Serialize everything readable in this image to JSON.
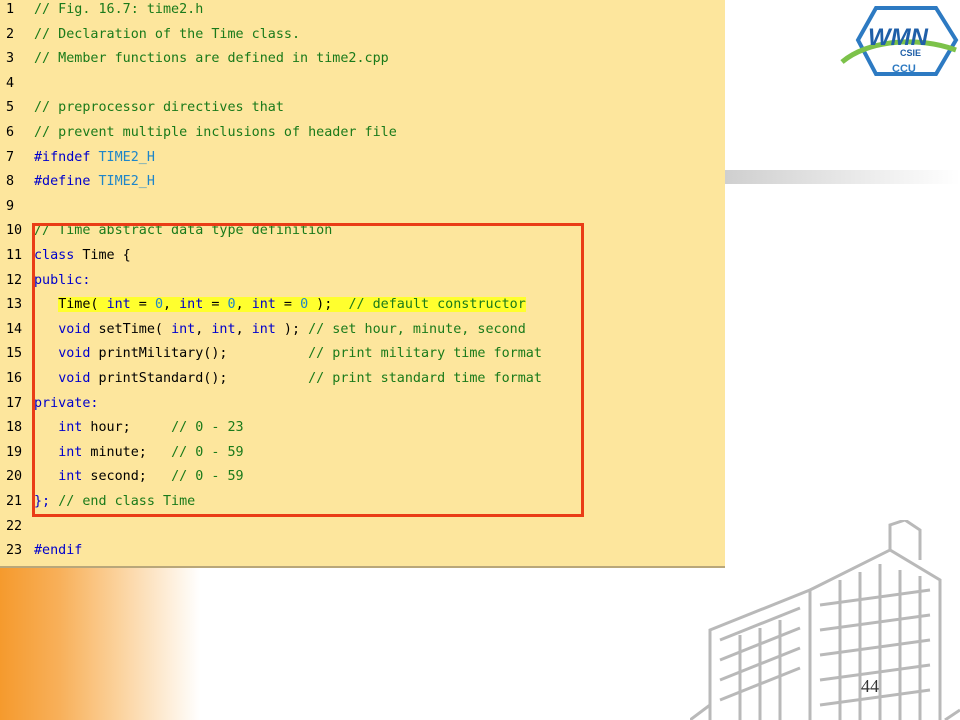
{
  "slide": {
    "page_number": "44",
    "logo": {
      "text_main": "WMN",
      "text_sub": "CSIE",
      "text_bottom": "CCU"
    },
    "colors": {
      "panel_bg": "#fde69d",
      "highlight": "#ffff2e",
      "box_border": "#ea3c16",
      "comment": "#1a7a1a",
      "keyword": "#0000cc",
      "number": "#1f86c9"
    }
  },
  "code": [
    {
      "n": "1",
      "t": "// Fig. 16.7: time2.h"
    },
    {
      "n": "2",
      "t": "// Declaration of the Time class."
    },
    {
      "n": "3",
      "t": "// Member functions are defined in time2.cpp"
    },
    {
      "n": "4",
      "t": ""
    },
    {
      "n": "5",
      "t": "// preprocessor directives that"
    },
    {
      "n": "6",
      "t": "// prevent multiple inclusions of header file"
    },
    {
      "n": "7",
      "a": "#ifndef",
      "b": "TIME2_H"
    },
    {
      "n": "8",
      "a": "#define",
      "b": "TIME2_H"
    },
    {
      "n": "9",
      "t": ""
    },
    {
      "n": "10",
      "t": "// Time abstract data type definition"
    },
    {
      "n": "11",
      "a": "class",
      "b": " Time {"
    },
    {
      "n": "12",
      "t": "public:"
    },
    {
      "n": "13",
      "p": [
        "Time( ",
        "int",
        " = ",
        "0",
        ", ",
        "int",
        " = ",
        "0",
        ", ",
        "int",
        " = ",
        "0",
        " );  ",
        "// default constructor"
      ]
    },
    {
      "n": "14",
      "p": [
        "void",
        " setTime( ",
        "int",
        ", ",
        "int",
        ", ",
        "int",
        " ); ",
        "// set hour, minute, second"
      ]
    },
    {
      "n": "15",
      "p": [
        "void",
        " printMilitary();          ",
        "// print military time format"
      ]
    },
    {
      "n": "16",
      "p": [
        "void",
        " printStandard();          ",
        "// print standard time format"
      ]
    },
    {
      "n": "17",
      "t": "private:"
    },
    {
      "n": "18",
      "p": [
        "int",
        " hour;     ",
        "// 0 - 23"
      ]
    },
    {
      "n": "19",
      "p": [
        "int",
        " minute;   ",
        "// 0 - 59"
      ]
    },
    {
      "n": "20",
      "p": [
        "int",
        " second;   ",
        "// 0 - 59"
      ]
    },
    {
      "n": "21",
      "p": [
        "};",
        " ",
        "// end class Time"
      ]
    },
    {
      "n": "22",
      "t": ""
    },
    {
      "n": "23",
      "t": "#endif"
    }
  ]
}
